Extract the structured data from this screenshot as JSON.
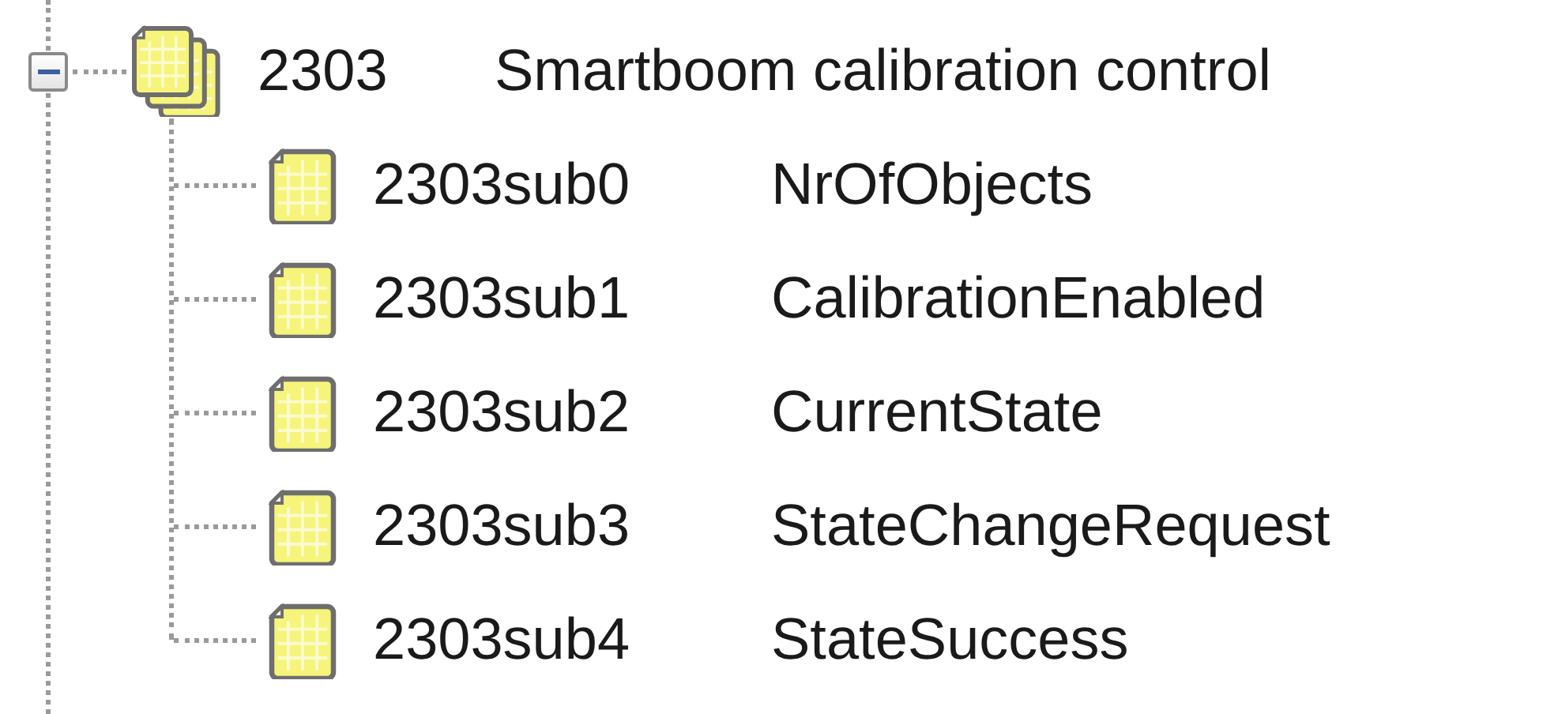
{
  "tree": [
    {
      "index": "2303",
      "name": "Smartboom calibration control",
      "expanded": true,
      "children": [
        {
          "index": "2303sub0",
          "name": "NrOfObjects"
        },
        {
          "index": "2303sub1",
          "name": "CalibrationEnabled"
        },
        {
          "index": "2303sub2",
          "name": "CurrentState"
        },
        {
          "index": "2303sub3",
          "name": "StateChangeRequest"
        },
        {
          "index": "2303sub4",
          "name": "StateSuccess"
        }
      ]
    }
  ]
}
